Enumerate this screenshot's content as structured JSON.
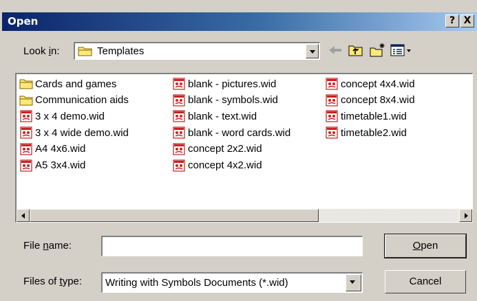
{
  "window": {
    "title": "Open",
    "help_label": "?",
    "close_label": "X"
  },
  "lookin": {
    "label": "Look in:",
    "value": "Templates"
  },
  "toolbar": {
    "icons": [
      "back-arrow-icon",
      "up-folder-icon",
      "new-folder-icon",
      "view-menu-icon"
    ]
  },
  "files": [
    {
      "name": "Cards and games",
      "type": "folder"
    },
    {
      "name": "Communication aids",
      "type": "folder"
    },
    {
      "name": "3 x 4 demo.wid",
      "type": "wid"
    },
    {
      "name": "3 x 4 wide demo.wid",
      "type": "wid"
    },
    {
      "name": "A4 4x6.wid",
      "type": "wid"
    },
    {
      "name": "A5 3x4.wid",
      "type": "wid"
    },
    {
      "name": "blank - pictures.wid",
      "type": "wid"
    },
    {
      "name": "blank - symbols.wid",
      "type": "wid"
    },
    {
      "name": "blank - text.wid",
      "type": "wid"
    },
    {
      "name": "blank - word cards.wid",
      "type": "wid"
    },
    {
      "name": "concept 2x2.wid",
      "type": "wid"
    },
    {
      "name": "concept 4x2.wid",
      "type": "wid"
    },
    {
      "name": "concept 4x4.wid",
      "type": "wid"
    },
    {
      "name": "concept 8x4.wid",
      "type": "wid"
    },
    {
      "name": "timetable1.wid",
      "type": "wid"
    },
    {
      "name": "timetable2.wid",
      "type": "wid"
    }
  ],
  "filename": {
    "label": "File name:",
    "value": ""
  },
  "filetype": {
    "label": "Files of type:",
    "value": "Writing with Symbols Documents (*.wid)"
  },
  "buttons": {
    "open": "Open",
    "cancel": "Cancel"
  },
  "colors": {
    "titlebar_start": "#0a246a",
    "titlebar_end": "#a6caf0",
    "face": "#d4d0c8",
    "folder_yellow": "#ffe878",
    "wid_red": "#d02020"
  }
}
